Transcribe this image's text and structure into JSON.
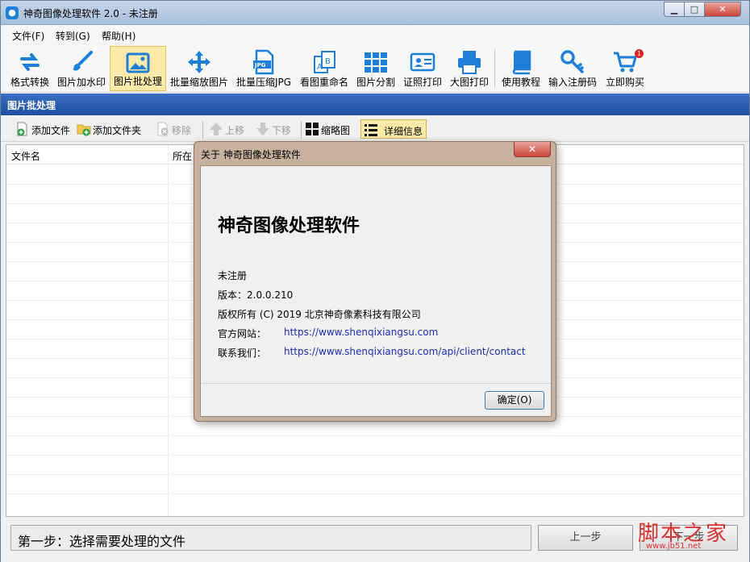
{
  "window": {
    "title": "神奇图像处理软件 2.0 - 未注册",
    "controls": {
      "minimize": "▁",
      "maximize": "□",
      "close": "✕"
    }
  },
  "menu": [
    "文件(F)",
    "转到(G)",
    "帮助(H)"
  ],
  "toolbar": [
    {
      "label": "格式转换",
      "icon": "convert-icon"
    },
    {
      "label": "图片加水印",
      "icon": "brush-icon"
    },
    {
      "label": "图片批处理",
      "icon": "image-icon",
      "active": true
    },
    {
      "label": "批量缩放图片",
      "icon": "move-arrows-icon"
    },
    {
      "label": "批量压缩JPG",
      "icon": "jpg-file-icon"
    },
    {
      "label": "看图重命名",
      "icon": "rename-icon"
    },
    {
      "label": "图片分割",
      "icon": "grid-icon"
    },
    {
      "label": "证照打印",
      "icon": "id-card-icon"
    },
    {
      "label": "大图打印",
      "icon": "printer-icon"
    },
    {
      "label": "使用教程",
      "icon": "book-icon"
    },
    {
      "label": "输入注册码",
      "icon": "key-icon"
    },
    {
      "label": "立即购买",
      "icon": "cart-icon",
      "badge": "1"
    }
  ],
  "section": {
    "title": "图片批处理"
  },
  "subtoolbar": {
    "add_file": "添加文件",
    "add_folder": "添加文件夹",
    "remove": "移除",
    "move_up": "上移",
    "move_down": "下移",
    "thumbnail": "缩略图",
    "details": "详细信息"
  },
  "list": {
    "columns": [
      "文件名",
      "所在"
    ]
  },
  "status": {
    "step": "第一步：选择需要处理的文件",
    "prev": "上一步",
    "next": "下一步"
  },
  "watermark": {
    "text": "脚本之家",
    "url": "www.jb51.net"
  },
  "dialog": {
    "title": "关于 神奇图像处理软件",
    "close": "✕",
    "heading": "神奇图像处理软件",
    "registration": "未注册",
    "version": "版本：2.0.0.210",
    "copyright": "版权所有 (C) 2019 北京神奇像素科技有限公司",
    "website_label": "官方网站：",
    "website_url": "https://www.shenqixiangsu.com",
    "contact_label": "联系我们：",
    "contact_url": "https://www.shenqixiangsu.com/api/client/contact",
    "ok": "确定(O)"
  },
  "colors": {
    "accent": "#1f4f9e",
    "active_tool": "#fdeaa8",
    "link": "#1a2fb4",
    "close_red": "#c8453a"
  }
}
